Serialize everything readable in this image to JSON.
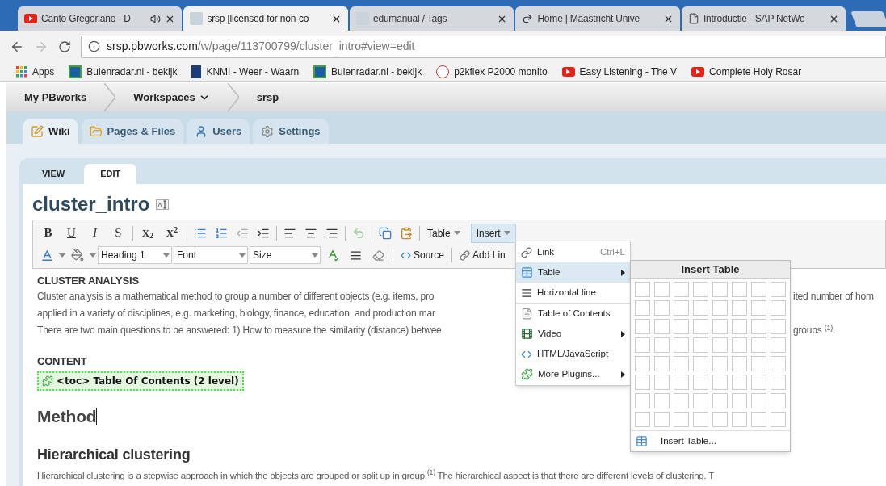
{
  "browser": {
    "tabs": [
      {
        "title": "Canto Gregoriano - D",
        "selected": false,
        "audio": true
      },
      {
        "title": "srsp [licensed for non-co",
        "selected": true,
        "audio": false
      },
      {
        "title": "edumanual / Tags",
        "selected": false,
        "audio": false
      },
      {
        "title": "Home | Maastricht Unive",
        "selected": false,
        "audio": false
      },
      {
        "title": "Introductie - SAP NetWe",
        "selected": false,
        "audio": false
      }
    ],
    "address": {
      "domain": "srsp.pbworks.com",
      "path": "/w/page/113700799/cluster_intro#view=edit"
    },
    "bookmarks": [
      "Apps",
      "Buienradar.nl - bekijk",
      "KNMI - Weer - Waarn",
      "Buienradar.nl - bekijk",
      "p2kflex P2000 monito",
      "Easy Listening - The V",
      "Complete Holy Rosar"
    ]
  },
  "breadcrumb": [
    {
      "label": "My PBworks",
      "kind": "link"
    },
    {
      "label": "Workspaces",
      "kind": "dropdown"
    },
    {
      "label": "srsp",
      "kind": "link"
    }
  ],
  "nav_tabs": [
    {
      "label": "Wiki",
      "selected": true
    },
    {
      "label": "Pages & Files",
      "selected": false
    },
    {
      "label": "Users",
      "selected": false
    },
    {
      "label": "Settings",
      "selected": false
    }
  ],
  "mode_tabs": [
    {
      "label": "VIEW",
      "selected": false
    },
    {
      "label": "EDIT",
      "selected": true
    }
  ],
  "page_title": "cluster_intro",
  "toolbar": {
    "format": [
      "B",
      "U",
      "I",
      "S"
    ],
    "scripts": [
      "X$_{2}$",
      "X$^{2}$"
    ],
    "menus": [
      {
        "label": "Table",
        "open": false
      },
      {
        "label": "Insert",
        "open": true
      }
    ],
    "selects": [
      "Heading 1",
      "Font",
      "Size"
    ],
    "buttons": [
      "Source",
      "Add Lin"
    ]
  },
  "insert_menu": [
    {
      "label": "Link",
      "shortcut": "Ctrl+L",
      "submenu": false,
      "selected": false
    },
    {
      "label": "Table",
      "submenu": true,
      "selected": true
    },
    {
      "label": "Horizontal line",
      "submenu": false,
      "selected": false
    },
    {
      "label": "Table of Contents",
      "submenu": false,
      "selected": false
    },
    {
      "label": "Video",
      "submenu": true,
      "selected": false
    },
    {
      "label": "HTML/JavaScript",
      "submenu": false,
      "selected": false
    },
    {
      "label": "More Plugins...",
      "submenu": true,
      "selected": false
    }
  ],
  "insert_table": {
    "title": "Insert Table",
    "footer": "Insert Table..."
  },
  "content": {
    "heading": "CLUSTER ANALYSIS",
    "lines": [
      {
        "left": "Cluster analysis is a mathematical method to group a number of different objects (e.g. items, pro",
        "right": "ited number of hom"
      },
      {
        "left": "applied in a variety of disciplines, e.g. marketing, biology, finance, education, and production mar"
      },
      {
        "left": "There are two main questions to be answered: 1) How to measure the similarity (distance) betwee",
        "right": "groups $^{(1)}$."
      }
    ],
    "section": "CONTENT",
    "toc": "<toc> Table Of Contents (2 level)",
    "h1": "Method",
    "h2": "Hierarchical clustering",
    "paragraph": "Hierarchical clustering is a stepwise approach in which the objects are grouped or split up in group.$^{(1)}$ The hierarchical aspect is that there are different levels of clustering. T"
  }
}
